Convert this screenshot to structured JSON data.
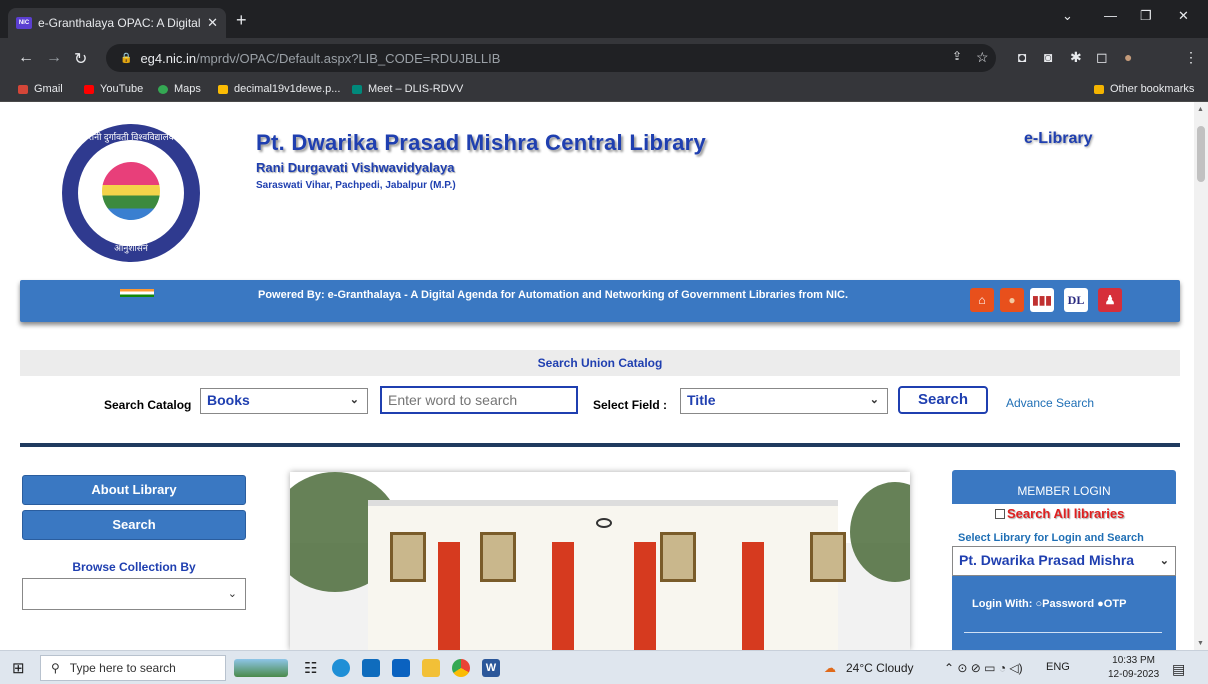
{
  "browser": {
    "tab_favicon": "NIC",
    "tab_title": "e-Granthalaya OPAC: A Digital A",
    "tab_close": "✕",
    "new_tab": "+",
    "url_host": "eg4.nic.in",
    "url_path": "/mprdv/OPAC/Default.aspx?LIB_CODE=RDUJBLLIB",
    "bookmarks": [
      "Gmail",
      "YouTube",
      "Maps",
      "decimal19v1dewe.p...",
      "Meet – DLIS-RDVV"
    ],
    "other_bookmarks": "Other bookmarks"
  },
  "header": {
    "seal_top_text": "रानी दुर्गावती विश्वविद्यालय",
    "seal_bottom_text": "आनुशासनं",
    "library_name": "Pt. Dwarika Prasad Mishra Central Library",
    "university": "Rani Durgavati Vishwavidyalaya",
    "address": "Saraswati Vihar, Pachpedi, Jabalpur (M.P.)",
    "e_library": "e-Library"
  },
  "banner": {
    "powered_by": "Powered By: e-Granthalaya - A Digital Agenda for Automation and Networking of Government Libraries from NIC.",
    "icons": [
      "home-icon",
      "user-icon",
      "stats-icon",
      "dl-icon",
      "author-icon"
    ],
    "dl_text": "DL"
  },
  "search": {
    "heading": "Search Union Catalog",
    "catalog_label": "Search Catalog",
    "catalog_value": "Books",
    "input_placeholder": "Enter word to search",
    "field_label": "Select Field :",
    "field_value": "Title",
    "button": "Search",
    "advance": "Advance Search"
  },
  "left": {
    "about": "About Library",
    "search": "Search",
    "browse_label": "Browse Collection By",
    "browse_value": ""
  },
  "member": {
    "heading": "MEMBER LOGIN",
    "search_all": "Search All libraries",
    "select_label": "Select Library for Login and Search",
    "library_value": "Pt. Dwarika Prasad Mishra",
    "login_with": "Login With:",
    "opt_password": "Password",
    "opt_otp": "OTP"
  },
  "taskbar": {
    "search_placeholder": "Type here to search",
    "weather": "24°C  Cloudy",
    "lang": "ENG",
    "time": "10:33 PM",
    "date": "12-09-2023"
  },
  "colors": {
    "brand_blue": "#3a78c2",
    "title_blue": "#1f3fb0",
    "alert_red": "#e02020"
  }
}
